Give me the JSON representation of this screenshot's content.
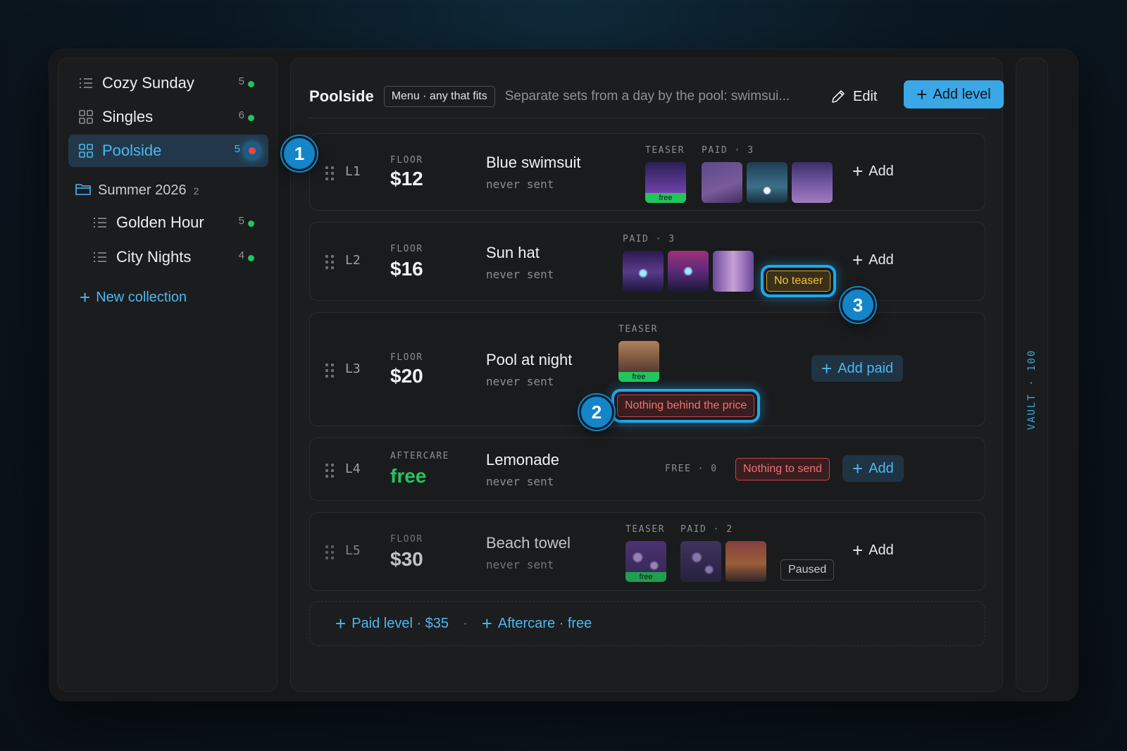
{
  "sidebar": {
    "items": [
      {
        "label": "Cozy Sunday",
        "count": "5"
      },
      {
        "label": "Singles",
        "count": "6"
      },
      {
        "label": "Poolside",
        "count": "5"
      }
    ],
    "folder": {
      "label": "Summer 2026",
      "count": "2"
    },
    "sub_items": [
      {
        "label": "Golden Hour",
        "count": "5"
      },
      {
        "label": "City Nights",
        "count": "4"
      }
    ],
    "new_collection": "New collection"
  },
  "header": {
    "title": "Poolside",
    "menu_chip": "Menu · any that fits",
    "description": "Separate sets from a day by the pool: swimsui...",
    "edit": "Edit",
    "add_level": "Add level"
  },
  "levels": [
    {
      "id": "L1",
      "tier": "FLOOR",
      "price": "$12",
      "name": "Blue swimsuit",
      "sent": "never sent",
      "teaser_label": "TEASER",
      "paid_label": "PAID · 3",
      "add": "Add"
    },
    {
      "id": "L2",
      "tier": "FLOOR",
      "price": "$16",
      "name": "Sun hat",
      "sent": "never sent",
      "paid_label": "PAID · 3",
      "warning": "No teaser",
      "add": "Add"
    },
    {
      "id": "L3",
      "tier": "FLOOR",
      "price": "$20",
      "name": "Pool at night",
      "sent": "never sent",
      "teaser_label": "TEASER",
      "error": "Nothing behind the price",
      "add": "Add paid"
    },
    {
      "id": "L4",
      "tier": "AFTERCARE",
      "price": "free",
      "name": "Lemonade",
      "sent": "never sent",
      "free_label": "FREE · 0",
      "error": "Nothing to send",
      "add": "Add"
    },
    {
      "id": "L5",
      "tier": "FLOOR",
      "price": "$30",
      "name": "Beach towel",
      "sent": "never sent",
      "teaser_label": "TEASER",
      "paid_label": "PAID · 2",
      "status": "Paused",
      "add": "Add"
    }
  ],
  "free_tag": "free",
  "footer": {
    "paid_level": "Paid level · $35",
    "separator": "·",
    "aftercare": "Aftercare · free"
  },
  "rail": {
    "label": "VAULT · 100"
  },
  "callouts": [
    "1",
    "2",
    "3"
  ],
  "colors": {
    "accent": "#3aa7e6",
    "success": "#22c55e",
    "warning": "#f2c23a",
    "danger": "#f07174"
  }
}
